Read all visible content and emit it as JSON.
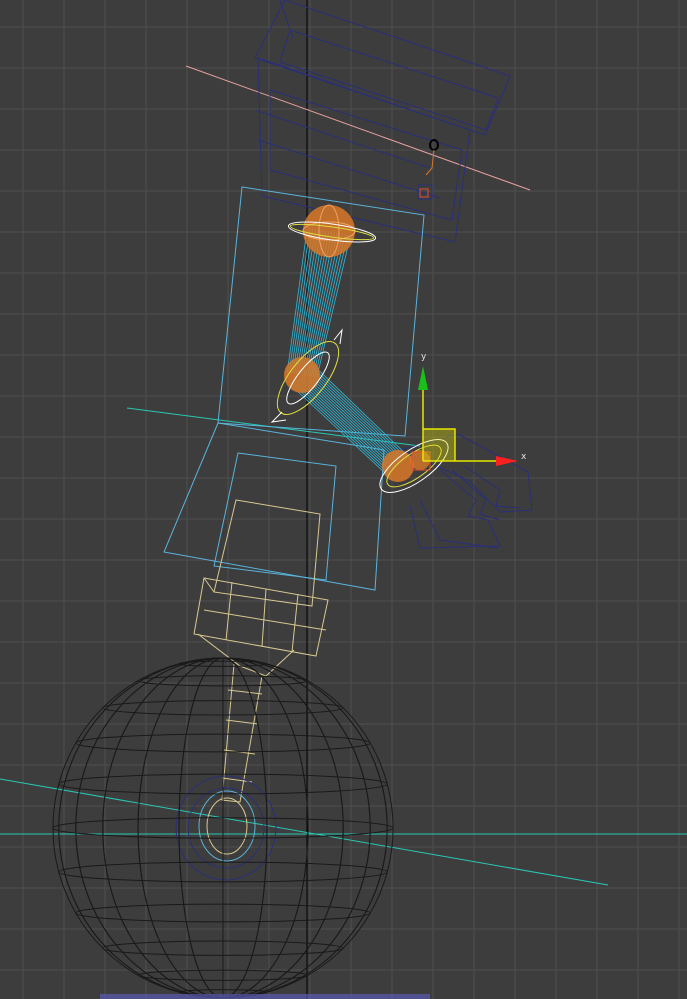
{
  "viewport": {
    "grid": true,
    "gizmo": {
      "x_label": "x",
      "y_label": "y",
      "x_color": "#ff2020",
      "y_color": "#18c018",
      "plane_color": "#e6e600"
    },
    "colors": {
      "background": "#3d3d3d",
      "grid_line": "#4e4e4e",
      "world_axis": "#000000",
      "ground_line": "#29c8b4",
      "pink_line": "#e6a0a0",
      "bone": "#30b8d8",
      "joint": "#d87828",
      "frame_outline": "#5ab4dc",
      "yellow_wire": "#d8c890",
      "sphere_wire": "#1a1a1a",
      "navy_wire": "#2a2f7a",
      "ellipse": "#dddd40",
      "white": "#ffffff"
    },
    "objects": [
      {
        "name": "upper-arm-bone",
        "kind": "bone"
      },
      {
        "name": "forearm-bone",
        "kind": "bone"
      },
      {
        "name": "shoulder-joint",
        "kind": "sphere"
      },
      {
        "name": "elbow-joint",
        "kind": "sphere"
      },
      {
        "name": "wrist-joint",
        "kind": "sphere"
      },
      {
        "name": "wheel-sphere",
        "kind": "wire-sphere"
      },
      {
        "name": "shoulder-mount",
        "kind": "box"
      },
      {
        "name": "hand-fingers",
        "kind": "mesh"
      }
    ]
  }
}
